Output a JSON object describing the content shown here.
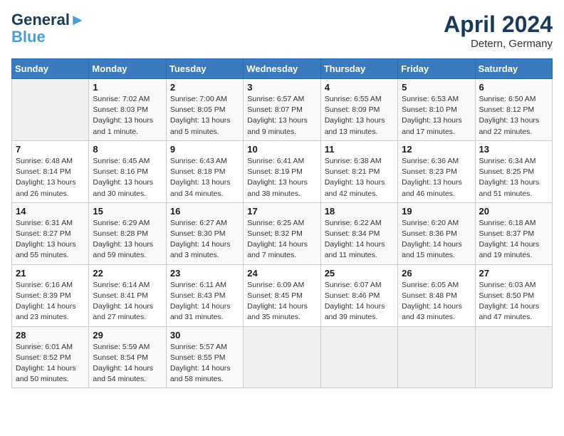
{
  "header": {
    "logo_line1": "General",
    "logo_line2": "Blue",
    "month_year": "April 2024",
    "location": "Detern, Germany"
  },
  "days_of_week": [
    "Sunday",
    "Monday",
    "Tuesday",
    "Wednesday",
    "Thursday",
    "Friday",
    "Saturday"
  ],
  "weeks": [
    [
      {
        "day": "",
        "info": ""
      },
      {
        "day": "1",
        "info": "Sunrise: 7:02 AM\nSunset: 8:03 PM\nDaylight: 13 hours\nand 1 minute."
      },
      {
        "day": "2",
        "info": "Sunrise: 7:00 AM\nSunset: 8:05 PM\nDaylight: 13 hours\nand 5 minutes."
      },
      {
        "day": "3",
        "info": "Sunrise: 6:57 AM\nSunset: 8:07 PM\nDaylight: 13 hours\nand 9 minutes."
      },
      {
        "day": "4",
        "info": "Sunrise: 6:55 AM\nSunset: 8:09 PM\nDaylight: 13 hours\nand 13 minutes."
      },
      {
        "day": "5",
        "info": "Sunrise: 6:53 AM\nSunset: 8:10 PM\nDaylight: 13 hours\nand 17 minutes."
      },
      {
        "day": "6",
        "info": "Sunrise: 6:50 AM\nSunset: 8:12 PM\nDaylight: 13 hours\nand 22 minutes."
      }
    ],
    [
      {
        "day": "7",
        "info": "Sunrise: 6:48 AM\nSunset: 8:14 PM\nDaylight: 13 hours\nand 26 minutes."
      },
      {
        "day": "8",
        "info": "Sunrise: 6:45 AM\nSunset: 8:16 PM\nDaylight: 13 hours\nand 30 minutes."
      },
      {
        "day": "9",
        "info": "Sunrise: 6:43 AM\nSunset: 8:18 PM\nDaylight: 13 hours\nand 34 minutes."
      },
      {
        "day": "10",
        "info": "Sunrise: 6:41 AM\nSunset: 8:19 PM\nDaylight: 13 hours\nand 38 minutes."
      },
      {
        "day": "11",
        "info": "Sunrise: 6:38 AM\nSunset: 8:21 PM\nDaylight: 13 hours\nand 42 minutes."
      },
      {
        "day": "12",
        "info": "Sunrise: 6:36 AM\nSunset: 8:23 PM\nDaylight: 13 hours\nand 46 minutes."
      },
      {
        "day": "13",
        "info": "Sunrise: 6:34 AM\nSunset: 8:25 PM\nDaylight: 13 hours\nand 51 minutes."
      }
    ],
    [
      {
        "day": "14",
        "info": "Sunrise: 6:31 AM\nSunset: 8:27 PM\nDaylight: 13 hours\nand 55 minutes."
      },
      {
        "day": "15",
        "info": "Sunrise: 6:29 AM\nSunset: 8:28 PM\nDaylight: 13 hours\nand 59 minutes."
      },
      {
        "day": "16",
        "info": "Sunrise: 6:27 AM\nSunset: 8:30 PM\nDaylight: 14 hours\nand 3 minutes."
      },
      {
        "day": "17",
        "info": "Sunrise: 6:25 AM\nSunset: 8:32 PM\nDaylight: 14 hours\nand 7 minutes."
      },
      {
        "day": "18",
        "info": "Sunrise: 6:22 AM\nSunset: 8:34 PM\nDaylight: 14 hours\nand 11 minutes."
      },
      {
        "day": "19",
        "info": "Sunrise: 6:20 AM\nSunset: 8:36 PM\nDaylight: 14 hours\nand 15 minutes."
      },
      {
        "day": "20",
        "info": "Sunrise: 6:18 AM\nSunset: 8:37 PM\nDaylight: 14 hours\nand 19 minutes."
      }
    ],
    [
      {
        "day": "21",
        "info": "Sunrise: 6:16 AM\nSunset: 8:39 PM\nDaylight: 14 hours\nand 23 minutes."
      },
      {
        "day": "22",
        "info": "Sunrise: 6:14 AM\nSunset: 8:41 PM\nDaylight: 14 hours\nand 27 minutes."
      },
      {
        "day": "23",
        "info": "Sunrise: 6:11 AM\nSunset: 8:43 PM\nDaylight: 14 hours\nand 31 minutes."
      },
      {
        "day": "24",
        "info": "Sunrise: 6:09 AM\nSunset: 8:45 PM\nDaylight: 14 hours\nand 35 minutes."
      },
      {
        "day": "25",
        "info": "Sunrise: 6:07 AM\nSunset: 8:46 PM\nDaylight: 14 hours\nand 39 minutes."
      },
      {
        "day": "26",
        "info": "Sunrise: 6:05 AM\nSunset: 8:48 PM\nDaylight: 14 hours\nand 43 minutes."
      },
      {
        "day": "27",
        "info": "Sunrise: 6:03 AM\nSunset: 8:50 PM\nDaylight: 14 hours\nand 47 minutes."
      }
    ],
    [
      {
        "day": "28",
        "info": "Sunrise: 6:01 AM\nSunset: 8:52 PM\nDaylight: 14 hours\nand 50 minutes."
      },
      {
        "day": "29",
        "info": "Sunrise: 5:59 AM\nSunset: 8:54 PM\nDaylight: 14 hours\nand 54 minutes."
      },
      {
        "day": "30",
        "info": "Sunrise: 5:57 AM\nSunset: 8:55 PM\nDaylight: 14 hours\nand 58 minutes."
      },
      {
        "day": "",
        "info": ""
      },
      {
        "day": "",
        "info": ""
      },
      {
        "day": "",
        "info": ""
      },
      {
        "day": "",
        "info": ""
      }
    ]
  ]
}
